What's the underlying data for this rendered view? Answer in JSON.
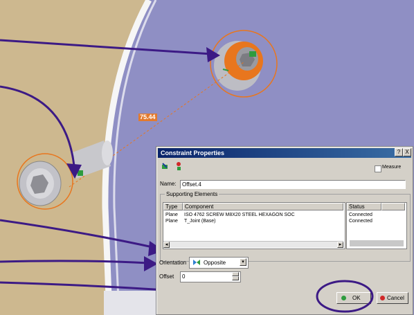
{
  "scene": {
    "dimension_label": "75.44"
  },
  "dialog": {
    "title": "Constraint Properties",
    "help_label": "?",
    "close_label": "X",
    "measure_label": "Measure",
    "name_label": "Name:",
    "name_value": "Offset.4",
    "group_label": "Supporting Elements",
    "columns": {
      "type": "Type",
      "component": "Component",
      "status": "Status"
    },
    "rows": [
      {
        "type": "Plane",
        "component": "ISO 4762 SCREW M8X20 STEEL HEXAGON SOC",
        "status": "Connected"
      },
      {
        "type": "Plane",
        "component": "T_Joint (Base)",
        "status": "Connected"
      }
    ],
    "orientation_label": "Orientation",
    "orientation_value": "Opposite",
    "offset_label": "Offset",
    "offset_value": "0",
    "ok_label": "OK",
    "cancel_label": "Cancel"
  },
  "colors": {
    "background": "#8f8fc4",
    "part": "#cdb88f",
    "arrow": "#3c1a85",
    "highlight": "#e8761e"
  }
}
